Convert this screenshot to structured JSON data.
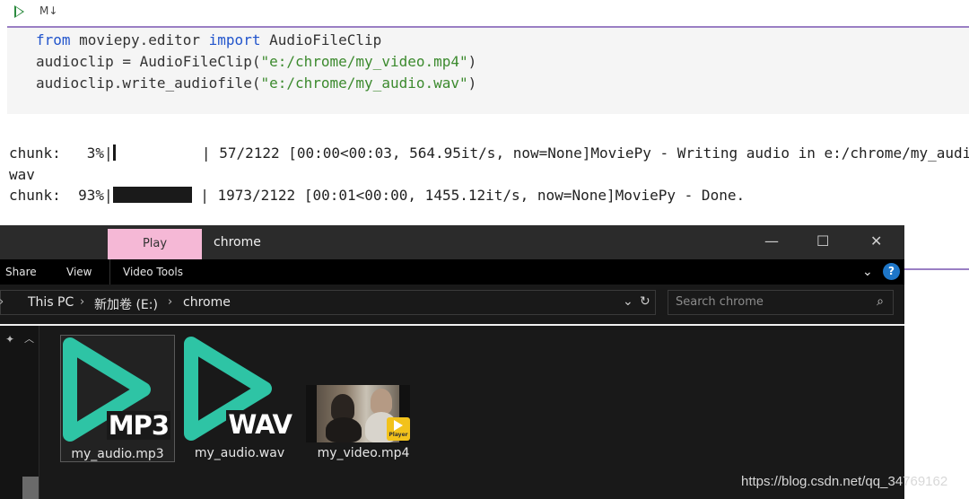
{
  "toolbar": {
    "run_icon": "play-icon",
    "markdown_label": "M↓"
  },
  "code": {
    "line1": {
      "kw1": "from",
      "mod": " moviepy.editor ",
      "kw2": "import",
      "rest": " AudioFileClip"
    },
    "line2": {
      "pre": "audioclip = AudioFileClip(",
      "arg": "\"e:/chrome/my_video.mp4\"",
      "post": ")"
    },
    "line3": {
      "pre": "audioclip.write_audiofile(",
      "arg": "\"e:/chrome/my_audio.wav\"",
      "post": ")"
    }
  },
  "output": {
    "line1_prefix": "chunk:   3%|",
    "line1_suffix": "          | 57/2122 [00:00<00:03, 564.95it/s, now=None]MoviePy - Writing audio in e:/chrome/my_audio.",
    "line1_progress": 0.03,
    "line2": "wav",
    "line3_prefix": "chunk:  93%|",
    "line3_suffix": " | 1973/2122 [00:01<00:00, 1455.12it/s, now=None]MoviePy - Done.",
    "line3_progress": 0.93
  },
  "explorer": {
    "contextual_tab": "Play",
    "title": "chrome",
    "window_controls": {
      "minimize": "—",
      "maximize": "☐",
      "close": "✕"
    },
    "ribbon_tabs": [
      "Share",
      "View",
      "Video Tools"
    ],
    "breadcrumb": [
      "This PC",
      "新加卷 (E:)",
      "chrome"
    ],
    "search_placeholder": "Search chrome",
    "files": [
      {
        "name": "my_audio.mp3",
        "badge": "MP3",
        "selected": true
      },
      {
        "name": "my_audio.wav",
        "badge": "WAV",
        "selected": false
      },
      {
        "name": "my_video.mp4",
        "badge": "Player",
        "selected": false
      }
    ],
    "accent_color": "#2ec4a5"
  },
  "watermark": "https://blog.csdn.net/qq_34769162"
}
